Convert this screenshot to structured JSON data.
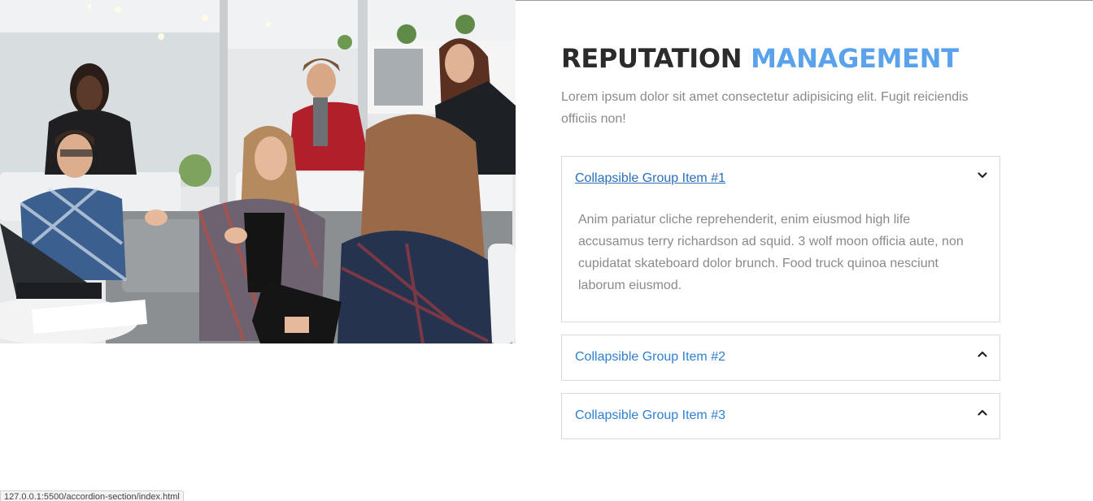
{
  "photo": {
    "alt_subject": "team-meeting-photo"
  },
  "heading": {
    "part1": "REPUTATION",
    "part2": "MANAGEMENT"
  },
  "lead_text": "Lorem ipsum dolor sit amet consectetur adipisicing elit. Fugit reiciendis officiis non!",
  "accordion": {
    "items": [
      {
        "title": "Collapsible Group Item #1",
        "expanded": true,
        "body": "Anim pariatur cliche reprehenderit, enim eiusmod high life accusamus terry richardson ad squid. 3 wolf moon officia aute, non cupidatat skateboard dolor brunch. Food truck quinoa nesciunt laborum eiusmod."
      },
      {
        "title": "Collapsible Group Item #2",
        "expanded": false
      },
      {
        "title": "Collapsible Group Item #3",
        "expanded": false
      }
    ]
  },
  "status_bar": {
    "url": "127.0.0.1:5500/accordion-section/index.html"
  },
  "colors": {
    "accent": "#5aa3ec",
    "link": "#2f80d1",
    "heading": "#2b2b2b",
    "text": "#8a8a8a",
    "border": "#d9d9d9"
  }
}
